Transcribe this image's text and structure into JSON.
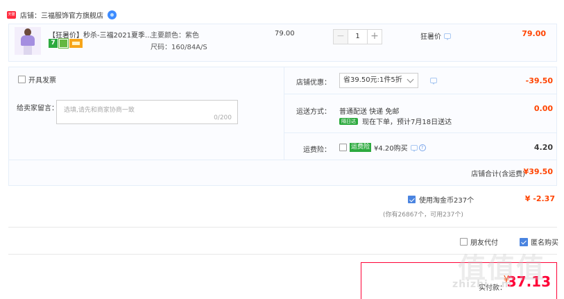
{
  "shop": {
    "logo_text": "天猫",
    "name": "店铺：三福服饰官方旗舰店"
  },
  "item": {
    "title": "【狂暑价】秒杀-三福2021夏季...",
    "color_label": "主要颜色：紫色",
    "size_label": "尺码：160/84A/S",
    "badge_text": "7",
    "unit_price": "79.00",
    "quantity": "1",
    "minus": "−",
    "plus": "+",
    "promo": "狂暑价",
    "subtotal": "79.00"
  },
  "options": {
    "invoice_label": "开具发票",
    "message_label": "给卖家留言：",
    "message_placeholder": "选填,请先和商家协商一致",
    "message_count": "0/200",
    "shop_discount_label": "店铺优惠：",
    "shop_discount_select": "省39.50元:1件5折",
    "shop_discount_amount": "-39.50",
    "shipping_label": "运送方式：",
    "shipping_method": "普通配送 快递 免邮",
    "nextday_tag": "隔日达",
    "shipping_note": "现在下单，预计7月18日送达",
    "shipping_amount": "0.00",
    "insurance_label": "运费险：",
    "insurance_tag": "运费险",
    "insurance_text": "¥4.20购买",
    "help": "?",
    "insurance_amount": "4.20",
    "shop_total_label": "店铺合计(含运费)",
    "shop_total_value": "¥39.50"
  },
  "coin": {
    "label": "使用淘金币237个",
    "sub": "(你有26867个，可用237个)",
    "value": "¥ -2.37"
  },
  "friend_pay": {
    "label": "朋友代付"
  },
  "anonymous": {
    "label": "匿名购买"
  },
  "pay": {
    "label": "实付款：",
    "currency": "¥",
    "amount": "37.13"
  },
  "watermark": {
    "glyphs": "值值值",
    "url": "zhizhi...m"
  },
  "colors": {
    "accent_red": "#ff4400",
    "checkbox_blue": "#4a84e0",
    "panel_bg": "#fbfcff"
  }
}
